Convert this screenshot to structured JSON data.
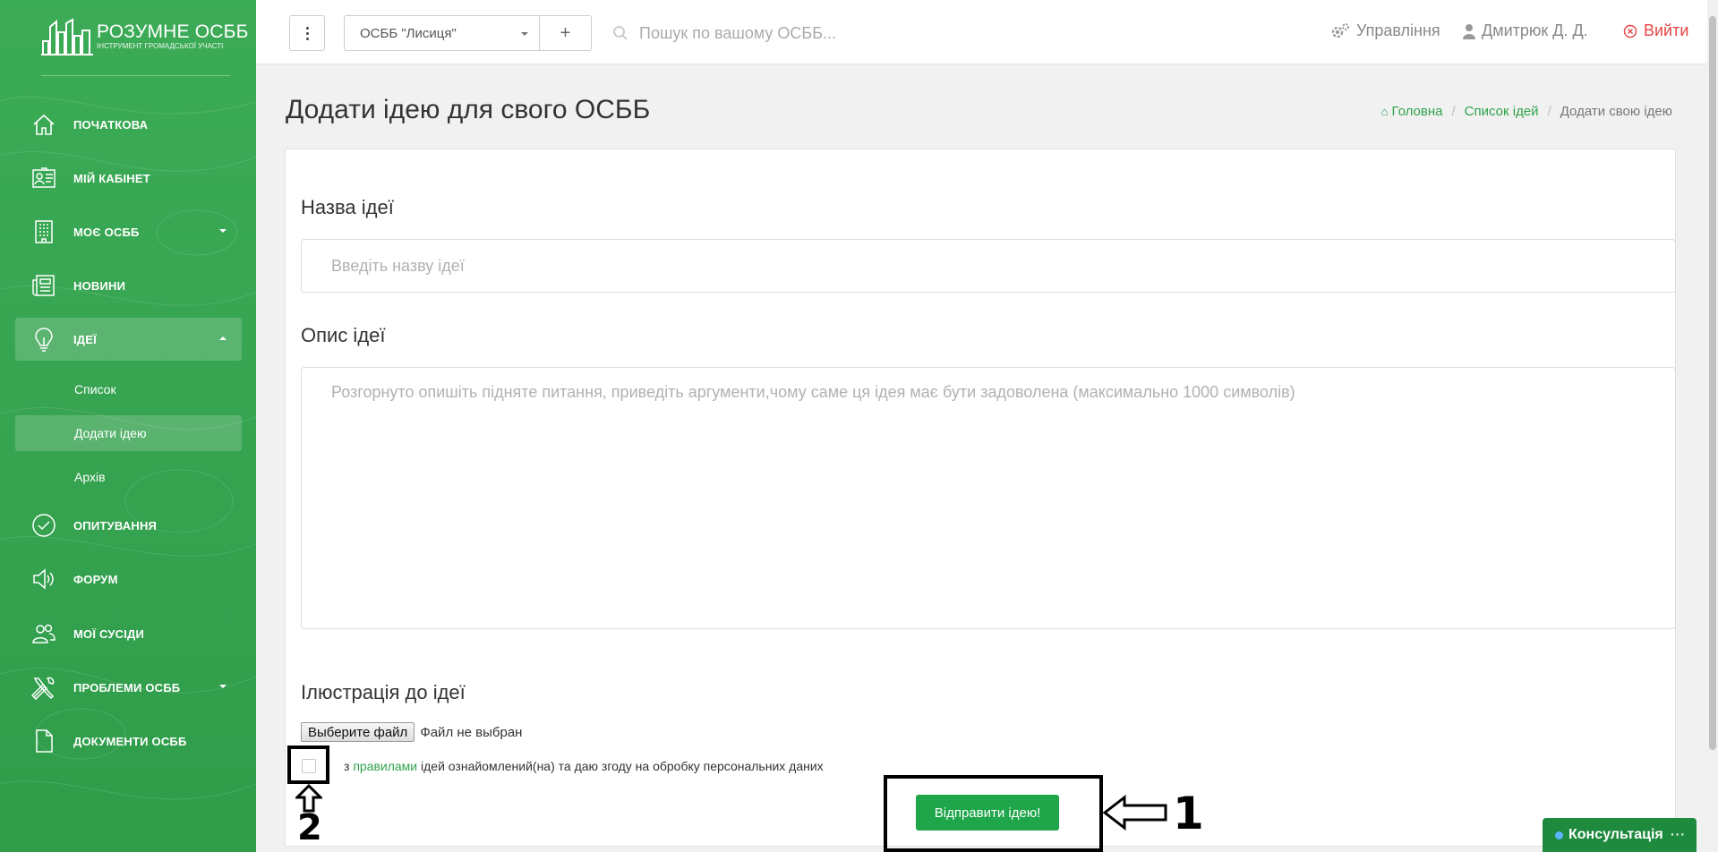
{
  "app": {
    "brand_name": "РОЗУМНЕ ОСББ",
    "brand_tagline": "ІНСТРУМЕНТ ГРОМАДСЬКОЇ УЧАСТІ"
  },
  "sidebar": {
    "items": [
      {
        "label": "ПОЧАТКОВА",
        "icon": "home-icon"
      },
      {
        "label": "МІЙ КАБІНЕТ",
        "icon": "profile-card-icon"
      },
      {
        "label": "МОЄ ОСББ",
        "icon": "building-icon"
      },
      {
        "label": "НОВИНИ",
        "icon": "newspaper-icon"
      },
      {
        "label": "ІДЕЇ",
        "icon": "lightbulb-icon"
      },
      {
        "label": "ОПИТУВАННЯ",
        "icon": "checkmark-circle-icon"
      },
      {
        "label": "ФОРУМ",
        "icon": "megaphone-icon"
      },
      {
        "label": "МОЇ СУСІДИ",
        "icon": "people-icon"
      },
      {
        "label": "ПРОБЛЕМИ ОСББ",
        "icon": "tools-icon"
      },
      {
        "label": "ДОКУМЕНТИ ОСББ",
        "icon": "document-icon"
      }
    ],
    "ideas_submenu": [
      {
        "label": "Список"
      },
      {
        "label": "Додати ідею"
      },
      {
        "label": "Архів"
      }
    ]
  },
  "topbar": {
    "osbb_selected": "ОСББ \"Лисиця\"",
    "search_placeholder": "Пошук по вашому ОСББ...",
    "management": "Управління",
    "user": "Дмитрюк Д. Д.",
    "logout": "Вийти"
  },
  "page": {
    "title": "Додати ідею для свого ОСББ",
    "breadcrumb": [
      "Головна",
      "Список ідей",
      "Додати свою ідею"
    ],
    "name_label": "Назва ідеї",
    "name_placeholder": "Введіть назву ідеї",
    "desc_label": "Опис ідеї",
    "desc_placeholder": "Розгорнуто опишіть підняте питання, приведіть аргументи,чому саме ця ідея має бути задоволена (максимально 1000 символів)",
    "illustration_label": "Ілюстрація до ідеї",
    "file_button": "Выберите файл",
    "file_status": "Файл не выбран",
    "agree_prefix": "з",
    "agree_link": "правилами",
    "agree_suffix": "ідей ознайомлений(на) та даю згоду на обробку персональних даних",
    "submit": "Відправити ідею!"
  },
  "annotations": {
    "submit_marker": "1",
    "checkbox_marker": "2"
  },
  "chat": {
    "label": "Консультація",
    "more": "···"
  },
  "colors": {
    "sidebar_green": "#36a651",
    "accent_green": "#1fa64a",
    "logout_red": "#e64343"
  }
}
